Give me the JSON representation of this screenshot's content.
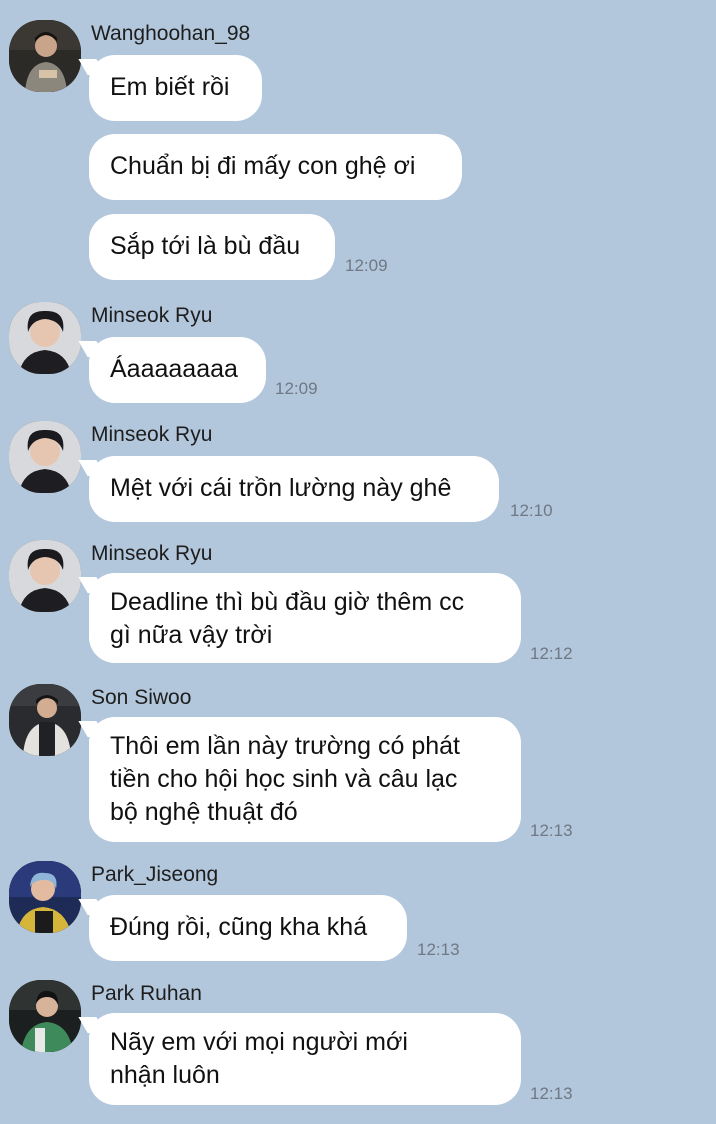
{
  "messages": [
    {
      "sender": "Wanghoohan_98",
      "avatar": "user-photo-icon",
      "bubbles": [
        {
          "lines": [
            "Em biết rồi"
          ]
        },
        {
          "lines": [
            "Chuẩn bị đi mấy con ghệ ơi"
          ]
        },
        {
          "lines": [
            "Sắp tới là bù đầu"
          ],
          "time": "12:09"
        }
      ]
    },
    {
      "sender": "Minseok Ryu",
      "avatar": "user-photo-icon",
      "bubbles": [
        {
          "lines": [
            "Áaaaaaaaa"
          ],
          "time": "12:09"
        }
      ]
    },
    {
      "sender": "Minseok Ryu",
      "avatar": "user-photo-icon",
      "bubbles": [
        {
          "lines": [
            "Mệt với cái trồn lường này ghê"
          ],
          "time": "12:10"
        }
      ]
    },
    {
      "sender": "Minseok Ryu",
      "avatar": "user-photo-icon",
      "bubbles": [
        {
          "lines": [
            "Deadline thì bù đầu giờ thêm cc",
            "gì nữa vậy trời"
          ],
          "time": "12:12"
        }
      ]
    },
    {
      "sender": "Son Siwoo",
      "avatar": "user-photo-icon",
      "bubbles": [
        {
          "lines": [
            "Thôi em lần này trường có phát",
            "tiền cho hội học sinh và câu lạc",
            "bộ nghệ thuật đó"
          ],
          "time": "12:13"
        }
      ]
    },
    {
      "sender": "Park_Jiseong",
      "avatar": "user-photo-icon",
      "bubbles": [
        {
          "lines": [
            "Đúng rồi, cũng kha khá"
          ],
          "time": "12:13"
        }
      ]
    },
    {
      "sender": "Park Ruhan",
      "avatar": "user-photo-icon",
      "bubbles": [
        {
          "lines": [
            "Nãy em với mọi người mới",
            "nhận luôn"
          ],
          "time": "12:13"
        }
      ]
    }
  ]
}
